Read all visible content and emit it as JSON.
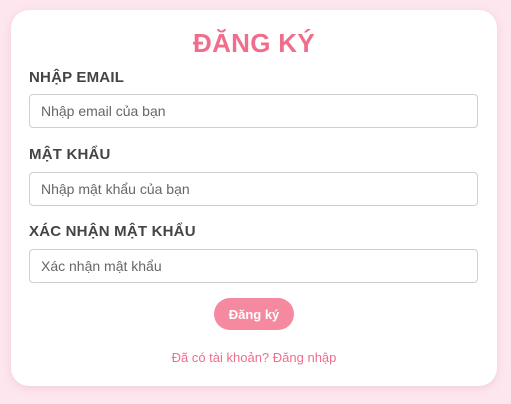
{
  "form": {
    "title": "ĐĂNG KÝ",
    "email": {
      "label": "NHẬP EMAIL",
      "value": "",
      "placeholder": "Nhập email của bạn"
    },
    "password": {
      "label": "MẬT KHẨU",
      "value": "",
      "placeholder": "Nhập mật khẩu của bạn"
    },
    "confirm_password": {
      "label": "XÁC NHẬN MẬT KHẨU",
      "value": "",
      "placeholder": "Xác nhận mật khẩu"
    },
    "submit_label": "Đăng ký",
    "login_link": "Đã có tài khoản? Đăng nhập"
  },
  "colors": {
    "background": "#fde6ee",
    "accent": "#f06d8c",
    "button": "#f4899f",
    "card": "#ffffff"
  }
}
